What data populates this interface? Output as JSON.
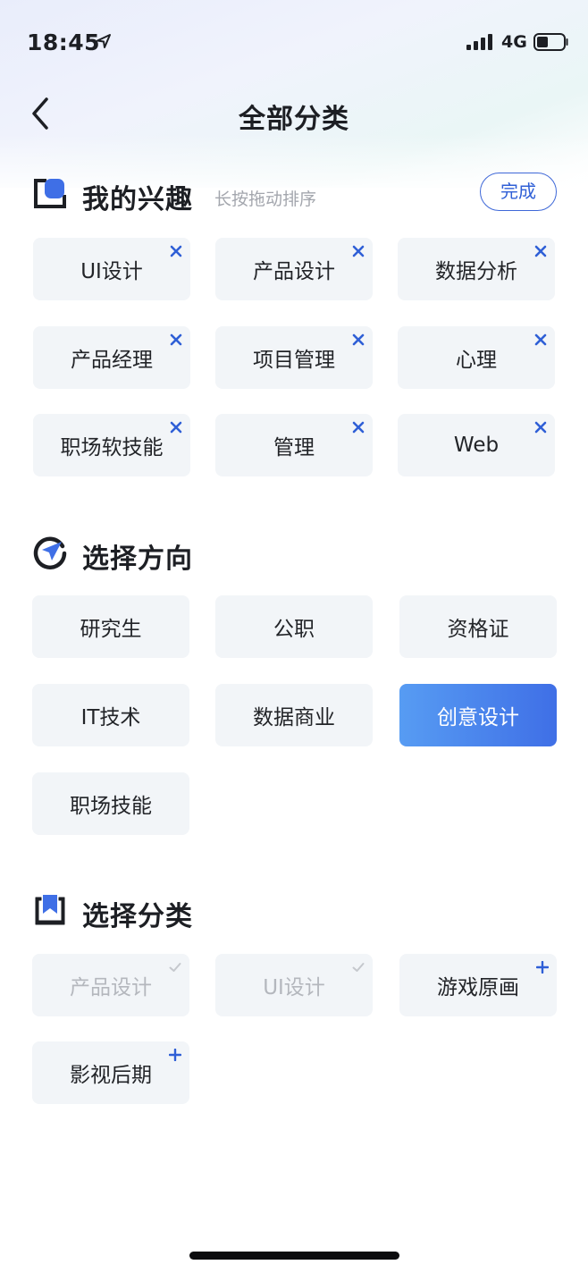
{
  "status_bar": {
    "time": "18:45",
    "network": "4G"
  },
  "header": {
    "title": "全部分类"
  },
  "interests": {
    "title": "我的兴趣",
    "hint": "长按拖动排序",
    "done_label": "完成",
    "items": [
      {
        "label": "UI设计"
      },
      {
        "label": "产品设计"
      },
      {
        "label": "数据分析"
      },
      {
        "label": "产品经理"
      },
      {
        "label": "项目管理"
      },
      {
        "label": "心理"
      },
      {
        "label": "职场软技能"
      },
      {
        "label": "管理"
      },
      {
        "label": "Web"
      }
    ]
  },
  "direction": {
    "title": "选择方向",
    "items": [
      {
        "label": "研究生"
      },
      {
        "label": "公职"
      },
      {
        "label": "资格证"
      },
      {
        "label": "IT技术"
      },
      {
        "label": "数据商业"
      },
      {
        "label": "创意设计",
        "selected": true
      },
      {
        "label": "职场技能"
      }
    ]
  },
  "category": {
    "title": "选择分类",
    "items": [
      {
        "label": "产品设计",
        "state": "added"
      },
      {
        "label": "UI设计",
        "state": "added"
      },
      {
        "label": "游戏原画",
        "state": "add"
      },
      {
        "label": "影视后期",
        "state": "add"
      }
    ]
  },
  "colors": {
    "accent": "#3f6fe6",
    "accent_light": "#579cf3",
    "tag_bg": "#f2f5f8",
    "remove_x": "#2f5fd6",
    "check": "#c5c8cd"
  }
}
